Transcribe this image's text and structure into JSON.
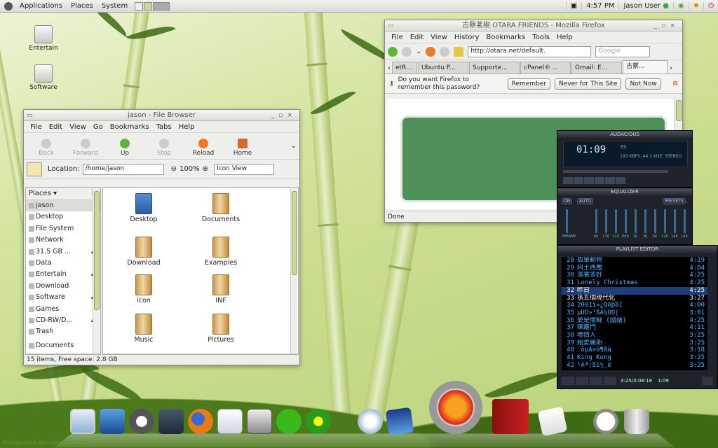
{
  "panel": {
    "menus": [
      "Applications",
      "Places",
      "System"
    ],
    "clock": "4:57 PM",
    "user": "jason User"
  },
  "desktop": {
    "icons": [
      {
        "label": "Entertain"
      },
      {
        "label": "Software"
      }
    ]
  },
  "file_browser": {
    "title": "jason - File Browser",
    "menus": [
      "File",
      "Edit",
      "View",
      "Go",
      "Bookmarks",
      "Tabs",
      "Help"
    ],
    "toolbar": {
      "back": "Back",
      "forward": "Forward",
      "up": "Up",
      "stop": "Stop",
      "reload": "Reload",
      "home": "Home"
    },
    "location_label": "Location:",
    "location": "/home/jason",
    "zoom": "100%",
    "view": "Icon View",
    "places_label": "Places",
    "places": [
      "jason",
      "Desktop",
      "File System",
      "Network",
      "31.5 GB ...",
      "Data",
      "Entertain",
      "Download",
      "Software",
      "Games",
      "CD-RW/D...",
      "Trash",
      "Documents"
    ],
    "files": [
      "Desktop",
      "Documents",
      "Download",
      "Examples",
      "icon",
      "INF",
      "Music",
      "Pictures"
    ],
    "status": "15 items, Free space: 2.8 GB"
  },
  "firefox": {
    "title": "古蔡茗樹 OTARA FRIENDS - Mozilla Firefox",
    "menus": [
      "File",
      "Edit",
      "View",
      "History",
      "Bookmarks",
      "Tools",
      "Help"
    ],
    "url": "http://otara.net/default.",
    "search_placeholder": "Google",
    "tabs": [
      "etR...",
      "Ubuntu P...",
      "Supporte...",
      "cPanel® ...",
      "Gmail: E...",
      "古蔡..."
    ],
    "notification": "Do you want Firefox to remember this password?",
    "remember": "Remember",
    "never": "Never for This Site",
    "not_now": "Not Now",
    "status": "Done"
  },
  "audacious": {
    "title": "AUDACIOUS",
    "time": "01:09",
    "track_no": "33.",
    "info": "193 KBPS. 44.1 KHZ. STEREO",
    "equalizer_title": "EQUALIZER",
    "on": "ON",
    "auto": "AUTO",
    "presets": "PRESETS",
    "eq_labels": [
      "PREAMP",
      "60",
      "170",
      "310",
      "600",
      "1K",
      "3K",
      "6K",
      "12K",
      "14K",
      "16K"
    ],
    "playlist_title": "PLAYLIST EDITOR",
    "playlist": [
      {
        "n": "28",
        "t": "孤單動物",
        "d": "4:19"
      },
      {
        "n": "29",
        "t": "阿土西塵",
        "d": "4:04"
      },
      {
        "n": "30",
        "t": "落著多好",
        "d": "4:25"
      },
      {
        "n": "31",
        "t": "Lonely Christmas",
        "d": "4:25"
      },
      {
        "n": "32",
        "t": "昨日",
        "d": "4:25"
      },
      {
        "n": "33",
        "t": "孫五個現代化",
        "d": "3:27"
      },
      {
        "n": "34",
        "t": "2001î»¿ÓÄþß[",
        "d": "4:00"
      },
      {
        "n": "35",
        "t": "µÚÒ»¹ßÀ½ÖÒ|",
        "d": "3:01"
      },
      {
        "n": "36",
        "t": "愛是懷疑 (國語)",
        "d": "4:25"
      },
      {
        "n": "37",
        "t": "陳籬門",
        "d": "4:11"
      },
      {
        "n": "38",
        "t": "壞情人",
        "d": "3:25"
      },
      {
        "n": "39",
        "t": "給愛麗斯",
        "d": "3:25"
      },
      {
        "n": "40",
        "t": "´õµÃ»õ¶ßã",
        "d": "3:18"
      },
      {
        "n": "41",
        "t": "King Kong",
        "d": "3:25"
      },
      {
        "n": "42",
        "t": "¹Ãª¦ßì½_ë",
        "d": "3:25"
      }
    ],
    "pl_time": "4:25/3:08:18",
    "pl_pos": "1:09"
  },
  "watermark": "missyusha.deviantart.com"
}
